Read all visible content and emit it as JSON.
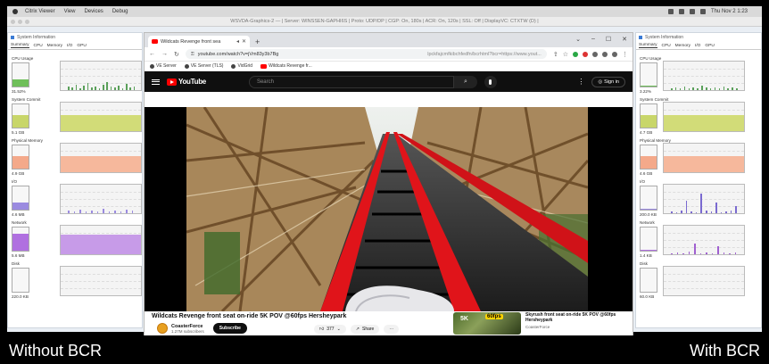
{
  "menubar": {
    "app": "Citrix Viewer",
    "items": [
      "View",
      "Devices",
      "Debug"
    ],
    "clock": "Thu Nov 2 1:23"
  },
  "remote_title": "WSVDA-Graphics-2 — | Server: WINSSEN-GAPHI6S | Proto: UDP/DP | CGP: On, 180s | ACR: On, 120s | SSL: Off | DisplayVC: CTXTW (D) |",
  "sysinfo_left": {
    "title": "System Information",
    "tabs": [
      "Summary",
      "CPU",
      "Memory",
      "I/O",
      "GPU"
    ],
    "metrics": [
      {
        "label": "CPU Usage",
        "value": "31.52%",
        "fill_pct": 32,
        "color": "#6fbf5a"
      },
      {
        "label": "System Commit",
        "value": "5.1 GB",
        "fill_pct": 55,
        "color": "#c8d66a"
      },
      {
        "label": "Physical Memory",
        "value": "4.9 GB",
        "fill_pct": 55,
        "color": "#f4a98a"
      },
      {
        "label": "I/O",
        "value": "4.6 MB",
        "fill_pct": 30,
        "color": "#9b8be0"
      },
      {
        "label": "Network",
        "value": "5.6 MB",
        "fill_pct": 75,
        "color": "#b070e0"
      },
      {
        "label": "Disk",
        "value": "220.0 KB",
        "fill_pct": 0,
        "color": "#cccccc"
      }
    ]
  },
  "sysinfo_right": {
    "title": "System Information",
    "tabs": [
      "Summary",
      "CPU",
      "Memory",
      "I/O",
      "GPU"
    ],
    "metrics": [
      {
        "label": "CPU Usage",
        "value": "3.22%",
        "fill_pct": 3,
        "color": "#6fbf5a"
      },
      {
        "label": "System Commit",
        "value": "4.7 GB",
        "fill_pct": 55,
        "color": "#c8d66a"
      },
      {
        "label": "Physical Memory",
        "value": "4.6 GB",
        "fill_pct": 55,
        "color": "#f4a98a"
      },
      {
        "label": "I/O",
        "value": "200.0 KB",
        "fill_pct": 4,
        "color": "#9b8be0"
      },
      {
        "label": "Network",
        "value": "1.4 KB",
        "fill_pct": 2,
        "color": "#b070e0"
      },
      {
        "label": "Disk",
        "value": "60.0 KB",
        "fill_pct": 0,
        "color": "#cccccc"
      }
    ]
  },
  "browser": {
    "tab_title": "Wildcats Revenge front sea",
    "url": "youtube.com/watch?v=jVm83y3b7Bg",
    "url_right": "lpckfajcmfkibchfedfn/bcrhtml?bcr=https://www.yout...",
    "bookmarks": [
      "VE Server",
      "VE Server (TLS)",
      "VidGrid",
      "Wildcats Revenge fr..."
    ]
  },
  "youtube": {
    "logo": "YouTube",
    "search_placeholder": "Search",
    "signin": "Sign in",
    "video_title": "Wildcats Revenge front seat on-ride 5K POV @60fps Hersheypark",
    "channel": "CoasterForce",
    "subscribers": "1.27M subscribers",
    "subscribe": "Subscribe",
    "likes": "377",
    "share": "Share",
    "related_title": "Skyrush front seat on-ride 5K POV @60fps Hersheypark",
    "related_channel": "CoasterForce",
    "related_badge1": "5K",
    "related_badge2": "60fps"
  },
  "captions": {
    "left": "Without BCR",
    "right": "With BCR"
  }
}
